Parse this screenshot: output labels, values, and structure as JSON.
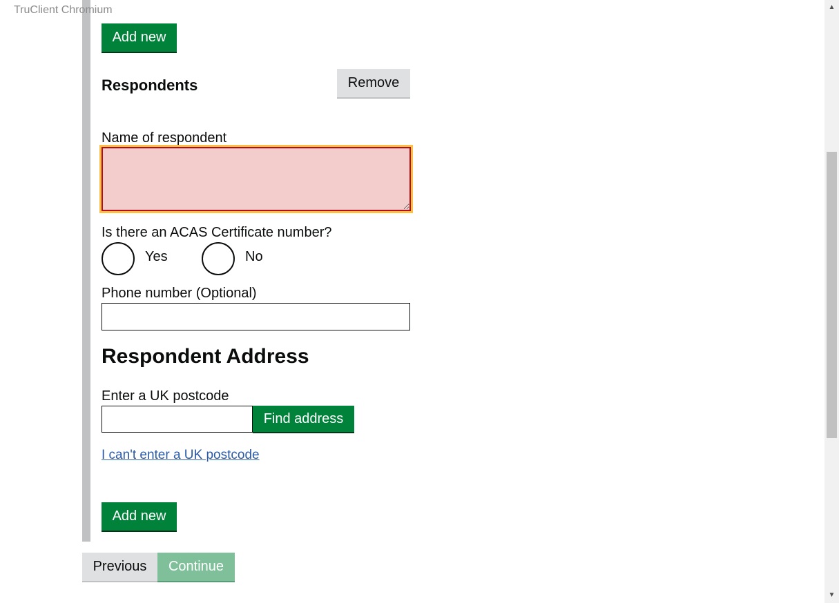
{
  "browser": {
    "label": "TruClient Chromium"
  },
  "top_add_new": "Add new",
  "respondents": {
    "title": "Respondents",
    "remove_label": "Remove",
    "name_label": "Name of respondent",
    "acas_question": "Is there an ACAS Certificate number?",
    "acas_options": [
      "Yes",
      "No"
    ],
    "phone_label": "Phone number (Optional)",
    "name_value": "",
    "phone_value": ""
  },
  "address": {
    "heading": "Respondent Address",
    "postcode_label": "Enter a UK postcode",
    "postcode_value": "",
    "find_label": "Find address",
    "no_postcode_link": "I can't enter a UK postcode"
  },
  "bottom_add_new": "Add new",
  "nav": {
    "previous": "Previous",
    "continue": "Continue"
  },
  "colors": {
    "primary_green": "#00823b",
    "disabled_green": "#7fc09b",
    "error_fill": "#f3cccc",
    "focus_outline": "#ffbf47",
    "link": "#2b5aa6"
  }
}
